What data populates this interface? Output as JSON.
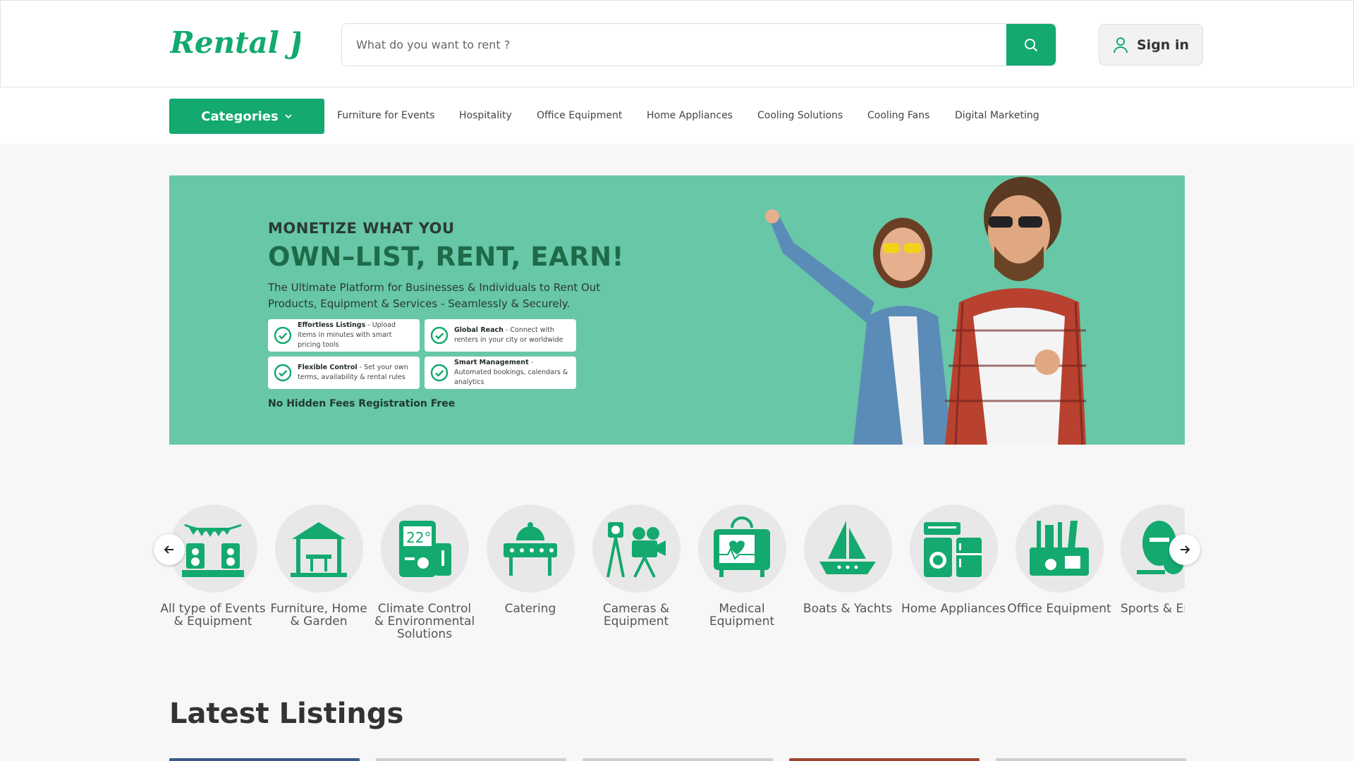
{
  "header": {
    "logo_text": "Rental Joy",
    "search_placeholder": "What do you want to rent ?",
    "search_icon": "search-icon",
    "signin_label": "Sign in",
    "signin_icon": "user-icon"
  },
  "nav": {
    "categories_label": "Categories",
    "links": [
      "Furniture for Events",
      "Hospitality",
      "Office Equipment",
      "Home Appliances",
      "Cooling Solutions",
      "Cooling Fans",
      "Digital Marketing"
    ]
  },
  "banner": {
    "small_heading": "MONETIZE WHAT YOU",
    "big_heading": "OWN–LIST, RENT, EARN!",
    "description": "The Ultimate Platform for Businesses & Individuals to Rent Out Products, Equipment & Services - Seamlessly & Securely.",
    "features": [
      {
        "title": "Effortless Listings",
        "text": " - Upload items in minutes with smart pricing tools"
      },
      {
        "title": "Global Reach",
        "text": " - Connect with renters in your city or worldwide"
      },
      {
        "title": "Flexible Control",
        "text": " - Set your own terms, availability & rental rules"
      },
      {
        "title": "Smart Management",
        "text": " - Automated bookings, calendars & analytics"
      }
    ],
    "footer": "No Hidden Fees Registration Free"
  },
  "categories": [
    {
      "label": "All type of Events & Equipment",
      "icon": "event-stage-icon"
    },
    {
      "label": "Furniture, Home & Garden",
      "icon": "gazebo-icon"
    },
    {
      "label": "Climate Control & Environmental Solutions",
      "icon": "thermostat-icon"
    },
    {
      "label": "Catering",
      "icon": "catering-cloche-icon"
    },
    {
      "label": "Cameras & Equipment",
      "icon": "film-camera-icon"
    },
    {
      "label": "Medical Equipment",
      "icon": "heart-monitor-icon"
    },
    {
      "label": "Boats & Yachts",
      "icon": "yacht-icon"
    },
    {
      "label": "Home Appliances",
      "icon": "appliances-icon"
    },
    {
      "label": "Office Equipment",
      "icon": "office-supplies-icon"
    },
    {
      "label": "Sports & Entertainment",
      "icon": "sports-balls-icon"
    }
  ],
  "carousel": {
    "prev_icon": "arrow-left-icon",
    "next_icon": "arrow-right-icon"
  },
  "latest": {
    "title": "Latest Listings"
  },
  "colors": {
    "brand": "#13a96f",
    "banner_bg": "#67c7a7",
    "page_bg": "#f7f7f7"
  }
}
